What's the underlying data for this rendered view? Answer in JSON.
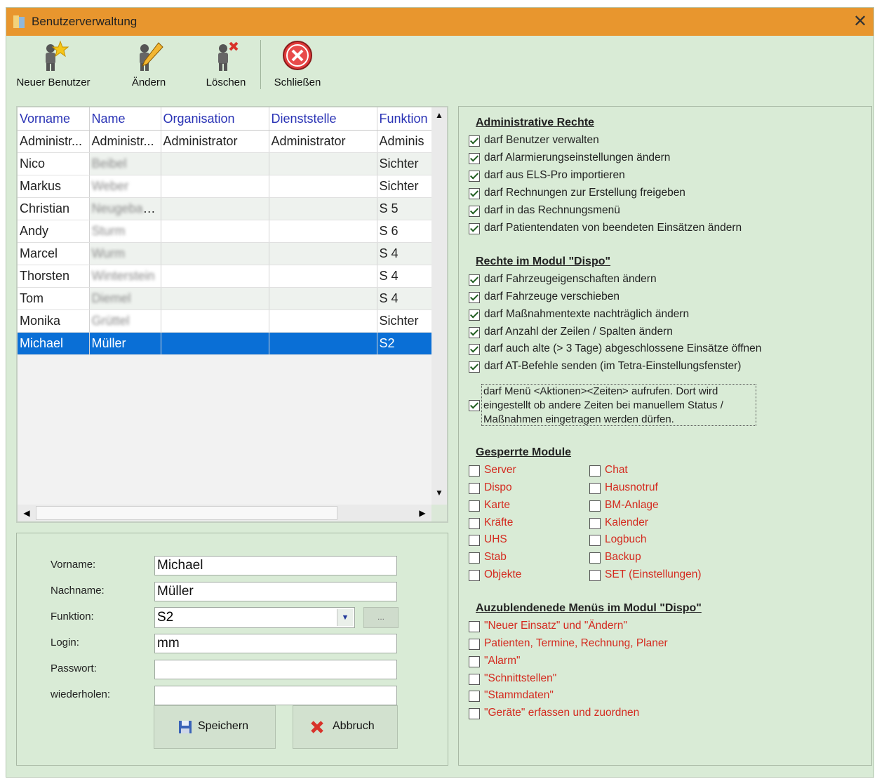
{
  "window": {
    "title": "Benutzerverwaltung",
    "close_glyph": "✕"
  },
  "toolbar": {
    "new_user": "Neuer Benutzer",
    "edit": "Ändern",
    "delete": "Löschen",
    "close": "Schließen"
  },
  "table": {
    "columns": [
      "Vorname",
      "Name",
      "Organisation",
      "Dienststelle",
      "Funktion"
    ],
    "rows": [
      {
        "vorname": "Administr...",
        "name": "Administr...",
        "organisation": "Administrator",
        "dienststelle": "Administrator",
        "funktion": "Adminis"
      },
      {
        "vorname": "Nico",
        "name": "Beibel",
        "organisation": "",
        "dienststelle": "",
        "funktion": "Sichter"
      },
      {
        "vorname": "Markus",
        "name": "Weber",
        "organisation": "",
        "dienststelle": "",
        "funktion": "Sichter"
      },
      {
        "vorname": "Christian",
        "name": "Neugebauer",
        "organisation": "",
        "dienststelle": "",
        "funktion": "S 5"
      },
      {
        "vorname": "Andy",
        "name": "Sturm",
        "organisation": "",
        "dienststelle": "",
        "funktion": "S 6"
      },
      {
        "vorname": "Marcel",
        "name": "Wurm",
        "organisation": "",
        "dienststelle": "",
        "funktion": "S 4"
      },
      {
        "vorname": "Thorsten",
        "name": "Winterstein",
        "organisation": "",
        "dienststelle": "",
        "funktion": "S 4"
      },
      {
        "vorname": "Tom",
        "name": "Diemel",
        "organisation": "",
        "dienststelle": "",
        "funktion": "S 4"
      },
      {
        "vorname": "Monika",
        "name": "Grüttel",
        "organisation": "",
        "dienststelle": "",
        "funktion": "Sichter"
      },
      {
        "vorname": "Michael",
        "name": "Müller",
        "organisation": "",
        "dienststelle": "",
        "funktion": "S2"
      }
    ],
    "selected_index": 9
  },
  "form": {
    "vorname_label": "Vorname:",
    "vorname_value": "Michael",
    "nachname_label": "Nachname:",
    "nachname_value": "Müller",
    "funktion_label": "Funktion:",
    "funktion_value": "S2",
    "dots_label": "...",
    "login_label": "Login:",
    "login_value": "mm",
    "passwort_label": "Passwort:",
    "passwort_value": "",
    "wiederholen_label": "wiederholen:",
    "wiederholen_value": "",
    "save_label": "Speichern",
    "cancel_label": "Abbruch"
  },
  "rights": {
    "admin_title": "Administrative Rechte",
    "admin_items": [
      {
        "label": "darf Benutzer verwalten",
        "checked": true
      },
      {
        "label": "darf Alarmierungseinstellungen ändern",
        "checked": true
      },
      {
        "label": "darf aus ELS-Pro importieren",
        "checked": true
      },
      {
        "label": "darf Rechnungen zur Erstellung freigeben",
        "checked": true
      },
      {
        "label": "darf in das Rechnungsmenü",
        "checked": true
      },
      {
        "label": "darf Patientendaten von beendeten Einsätzen ändern",
        "checked": true
      }
    ],
    "dispo_title": "Rechte im Modul \"Dispo\"",
    "dispo_items": [
      {
        "label": "darf Fahrzeugeigenschaften ändern",
        "checked": true
      },
      {
        "label": "darf Fahrzeuge verschieben",
        "checked": true
      },
      {
        "label": "darf Maßnahmentexte nachträglich ändern",
        "checked": true
      },
      {
        "label": "darf Anzahl der Zeilen / Spalten ändern",
        "checked": true
      },
      {
        "label": "darf auch alte (> 3 Tage) abgeschlossene Einsätze öffnen",
        "checked": true
      },
      {
        "label": "darf AT-Befehle senden (im Tetra-Einstellungsfenster)",
        "checked": true
      }
    ],
    "dispo_multiline": {
      "line1": "darf Menü <Aktionen><Zeiten> aufrufen. Dort wird",
      "line2": "eingestellt ob andere Zeiten  bei manuellem Status /",
      "line3": "Maßnahmen eingetragen werden dürfen.",
      "checked": true
    },
    "locked_title": "Gesperrte Module",
    "locked_left": [
      "Server",
      "Dispo",
      "Karte",
      "Kräfte",
      "UHS",
      "Stab",
      "Objekte"
    ],
    "locked_right": [
      "Chat",
      "Hausnotruf",
      "BM-Anlage",
      "Kalender",
      "Logbuch",
      "Backup",
      "SET (Einstellungen)"
    ],
    "hide_title": "Auzublendenede Menüs im Modul \"Dispo\"",
    "hide_items": [
      "\"Neuer Einsatz\" und \"Ändern\"",
      "Patienten, Termine, Rechnung, Planer",
      "\"Alarm\"",
      "\"Schnittstellen\"",
      "\"Stammdaten\"",
      "\"Geräte\" erfassen und zuordnen"
    ]
  },
  "colors": {
    "titlebar": "#e8962e",
    "window_bg": "#d9ebd6",
    "selection": "#0a6fd6",
    "header_text": "#2a33b5",
    "module_text": "#d42a1f"
  }
}
